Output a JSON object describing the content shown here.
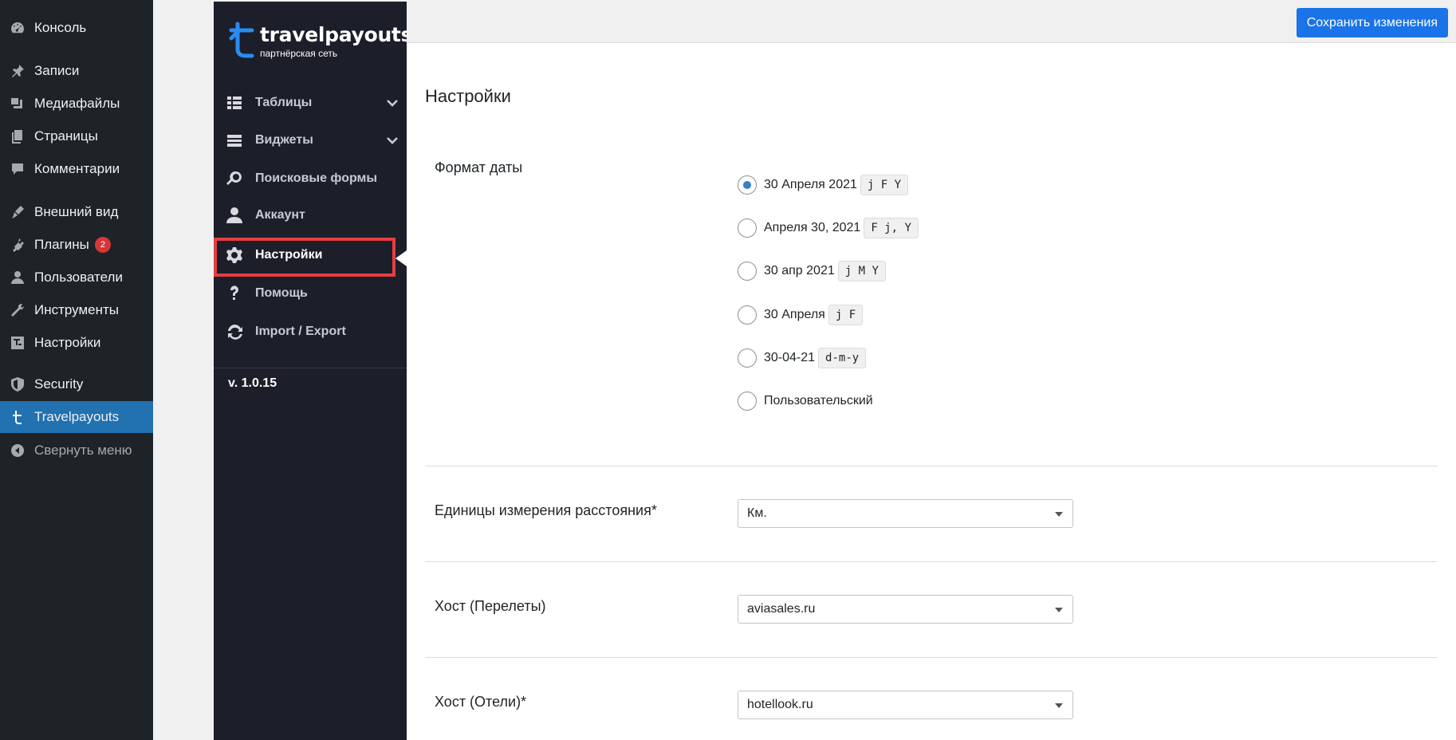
{
  "wp_menu": {
    "items": [
      {
        "label": "Консоль",
        "icon": "dashboard-icon"
      },
      {
        "label": "Записи",
        "icon": "pin-icon"
      },
      {
        "label": "Медиафайлы",
        "icon": "media-icon"
      },
      {
        "label": "Страницы",
        "icon": "pages-icon"
      },
      {
        "label": "Комментарии",
        "icon": "comments-icon"
      },
      {
        "label": "Внешний вид",
        "icon": "appearance-icon"
      },
      {
        "label": "Плагины",
        "icon": "plugins-icon",
        "badge": "2"
      },
      {
        "label": "Пользователи",
        "icon": "users-icon"
      },
      {
        "label": "Инструменты",
        "icon": "tools-icon"
      },
      {
        "label": "Настройки",
        "icon": "settings-icon"
      },
      {
        "label": "Security",
        "icon": "shield-icon"
      },
      {
        "label": "Travelpayouts",
        "icon": "travelpayouts-icon",
        "active": true
      },
      {
        "label": "Свернуть меню",
        "icon": "collapse-icon"
      }
    ]
  },
  "plugin": {
    "brand": "travelpayouts",
    "subtitle": "партнёрская сеть",
    "nav": [
      {
        "label": "Таблицы",
        "icon": "table-icon",
        "expandable": true
      },
      {
        "label": "Виджеты",
        "icon": "widgets-icon",
        "expandable": true
      },
      {
        "label": "Поисковые формы",
        "icon": "search-icon"
      },
      {
        "label": "Аккаунт",
        "icon": "user-icon"
      },
      {
        "label": "Настройки",
        "icon": "gear-icon",
        "selected": true
      },
      {
        "label": "Помощь",
        "icon": "question-icon"
      },
      {
        "label": "Import / Export",
        "icon": "sync-icon"
      }
    ],
    "version": "v. 1.0.15"
  },
  "toolbar": {
    "save_label": "Сохранить изменения"
  },
  "colors": {
    "accent": "#1a73e8",
    "highlight": "#e53e3e",
    "wp_active": "#2271b1"
  },
  "settings": {
    "title": "Настройки",
    "date_format": {
      "label": "Формат даты",
      "options": [
        {
          "label": "30 Апреля 2021",
          "code": "j F Y",
          "checked": true
        },
        {
          "label": "Апреля 30, 2021",
          "code": "F j, Y"
        },
        {
          "label": "30 апр 2021",
          "code": "j M Y"
        },
        {
          "label": "30 Апреля",
          "code": "j F"
        },
        {
          "label": "30-04-21",
          "code": "d-m-y"
        },
        {
          "label": "Пользовательский",
          "code": ""
        }
      ]
    },
    "distance": {
      "label": "Единицы измерения расстояния*",
      "value": "Км."
    },
    "flights_host": {
      "label": "Хост (Перелеты)",
      "value": "aviasales.ru"
    },
    "hotels_host": {
      "label": "Хост (Отели)*",
      "value": "hotellook.ru"
    }
  }
}
